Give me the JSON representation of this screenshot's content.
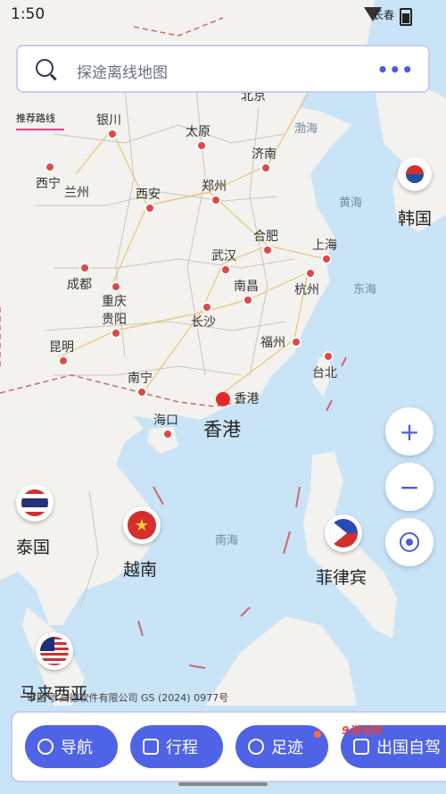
{
  "status_bar": {
    "time": "1:50",
    "carrier": "长春"
  },
  "search": {
    "placeholder": "探途离线地图",
    "more_label": "•••"
  },
  "tab": {
    "label": "推荐路线"
  },
  "map": {
    "cities": [
      {
        "name": "北京"
      },
      {
        "name": "银川"
      },
      {
        "name": "太原"
      },
      {
        "name": "济南"
      },
      {
        "name": "西宁"
      },
      {
        "name": "兰州"
      },
      {
        "name": "西安"
      },
      {
        "name": "郑州"
      },
      {
        "name": "合肥"
      },
      {
        "name": "上海"
      },
      {
        "name": "武汉"
      },
      {
        "name": "南昌"
      },
      {
        "name": "杭州"
      },
      {
        "name": "成都"
      },
      {
        "name": "重庆"
      },
      {
        "name": "贵阳"
      },
      {
        "name": "长沙"
      },
      {
        "name": "福州"
      },
      {
        "name": "昆明"
      },
      {
        "name": "台北"
      },
      {
        "name": "南宁"
      },
      {
        "name": "海口"
      },
      {
        "name": "香港"
      }
    ],
    "seas": [
      "渤海",
      "黄海",
      "东海",
      "南海"
    ],
    "countries": [
      {
        "name": "韩国",
        "flag_icon": "south-korea-flag-icon"
      },
      {
        "name": "泰国",
        "flag_icon": "thailand-flag-icon"
      },
      {
        "name": "越南",
        "flag_icon": "vietnam-flag-icon"
      },
      {
        "name": "菲律宾",
        "flag_icon": "philippines-flag-icon"
      },
      {
        "name": "马来西亚",
        "flag_icon": "malaysia-flag-icon"
      }
    ],
    "hongkong_label": "香港",
    "copyright": "审图号 高德软件有限公司 GS (2024) 0977号"
  },
  "controls": {
    "zoom_in": "+",
    "zoom_out": "−"
  },
  "bottom_nav": {
    "navigate": "导航",
    "trip": "行程",
    "footprint": "足迹",
    "abroad": "出国自驾"
  },
  "watermark": "9游戏网",
  "colors": {
    "accent": "#4f63e6",
    "land": "#f4f2ee",
    "sea": "#c9e3f7",
    "road": "#e7c47a"
  }
}
